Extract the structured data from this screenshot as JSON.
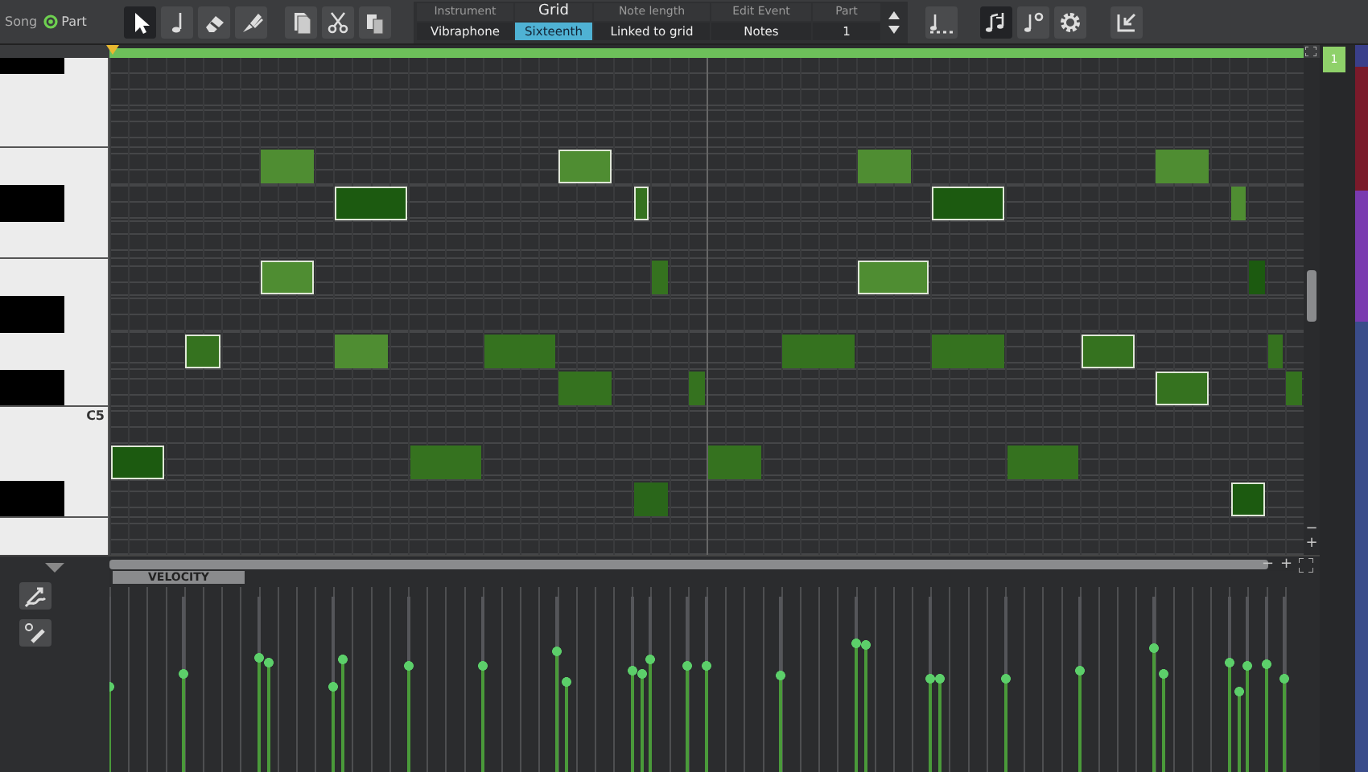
{
  "mode_switch": [
    {
      "label": "Song",
      "selected": false
    },
    {
      "label": "Part",
      "selected": true
    }
  ],
  "tools": [
    {
      "kind": "pointer",
      "selected": true
    },
    {
      "kind": "note",
      "selected": false
    },
    {
      "kind": "eraser",
      "selected": false
    },
    {
      "kind": "brush",
      "selected": false
    }
  ],
  "edit_tools": [
    {
      "kind": "copy"
    },
    {
      "kind": "cut"
    },
    {
      "kind": "paste"
    }
  ],
  "info_panel": {
    "columns": [
      {
        "header": "Instrument",
        "value": "Vibraphone",
        "selected": false
      },
      {
        "header": "Grid",
        "value": "Sixteenth",
        "selected": true
      },
      {
        "header": "Note length",
        "value": "Linked to grid",
        "selected": false
      },
      {
        "header": "Edit Event",
        "value": "Notes",
        "selected": false
      },
      {
        "header": "Part",
        "value": "1",
        "selected": false
      }
    ]
  },
  "view_tools": [
    {
      "kind": "quantize",
      "selected": false
    },
    {
      "kind": "note-input",
      "selected": true
    },
    {
      "kind": "note-step",
      "selected": false
    },
    {
      "kind": "settings",
      "selected": false
    },
    {
      "kind": "export",
      "selected": false
    }
  ],
  "part_badge": "1",
  "piano": {
    "label": "C5"
  },
  "notes": [
    {
      "color": "#4f8d32",
      "selected": false,
      "level": 0.68
    },
    {
      "color": "#4f8d32",
      "selected": true,
      "level": 0.72
    },
    {
      "color": "#4f8d32",
      "selected": false,
      "level": 0.76
    },
    {
      "color": "#4f8d32",
      "selected": false,
      "level": 0.73
    },
    {
      "color": "#1c5a10",
      "selected": true,
      "level": 0.51
    },
    {
      "color": "#35721f",
      "selected": true,
      "level": 0.61
    },
    {
      "color": "#1c5a10",
      "selected": true,
      "level": 0.56
    },
    {
      "color": "#4f8d32",
      "selected": false,
      "level": 0.65
    },
    {
      "color": "#4f8d32",
      "selected": true,
      "level": 0.65
    },
    {
      "color": "#35721f",
      "selected": false,
      "level": 0.67
    },
    {
      "color": "#4f8d32",
      "selected": true,
      "level": 0.75
    },
    {
      "color": "#1c5a10",
      "selected": false,
      "level": 0.63
    },
    {
      "color": "#35721f",
      "selected": true,
      "level": 0.59
    },
    {
      "color": "#4f8d32",
      "selected": false,
      "level": 0.67
    },
    {
      "color": "#35721f",
      "selected": false,
      "level": 0.63
    },
    {
      "color": "#35721f",
      "selected": false,
      "level": 0.58
    },
    {
      "color": "#35721f",
      "selected": false,
      "level": 0.56
    },
    {
      "color": "#35721f",
      "selected": true,
      "level": 0.61
    },
    {
      "color": "#35721f",
      "selected": false,
      "level": 0.64
    },
    {
      "color": "#35721f",
      "selected": false,
      "level": 0.54
    },
    {
      "color": "#35721f",
      "selected": false,
      "level": 0.63
    },
    {
      "color": "#35721f",
      "selected": true,
      "level": 0.59
    },
    {
      "color": "#35721f",
      "selected": false,
      "level": 0.56
    },
    {
      "color": "#1c5a10",
      "selected": true,
      "level": 0.51
    },
    {
      "color": "#35721f",
      "selected": false,
      "level": 0.63
    },
    {
      "color": "#35721f",
      "selected": false,
      "level": 0.63
    },
    {
      "color": "#35721f",
      "selected": false,
      "level": 0.56
    },
    {
      "color": "#2a661a",
      "selected": false,
      "level": 0.59
    },
    {
      "color": "#1c5a10",
      "selected": true,
      "level": 0.49
    }
  ],
  "vertical_zoom": [
    "−",
    "+"
  ],
  "horizontal_zoom": [
    "−",
    "+"
  ],
  "velocity_label": "VELOCITY"
}
